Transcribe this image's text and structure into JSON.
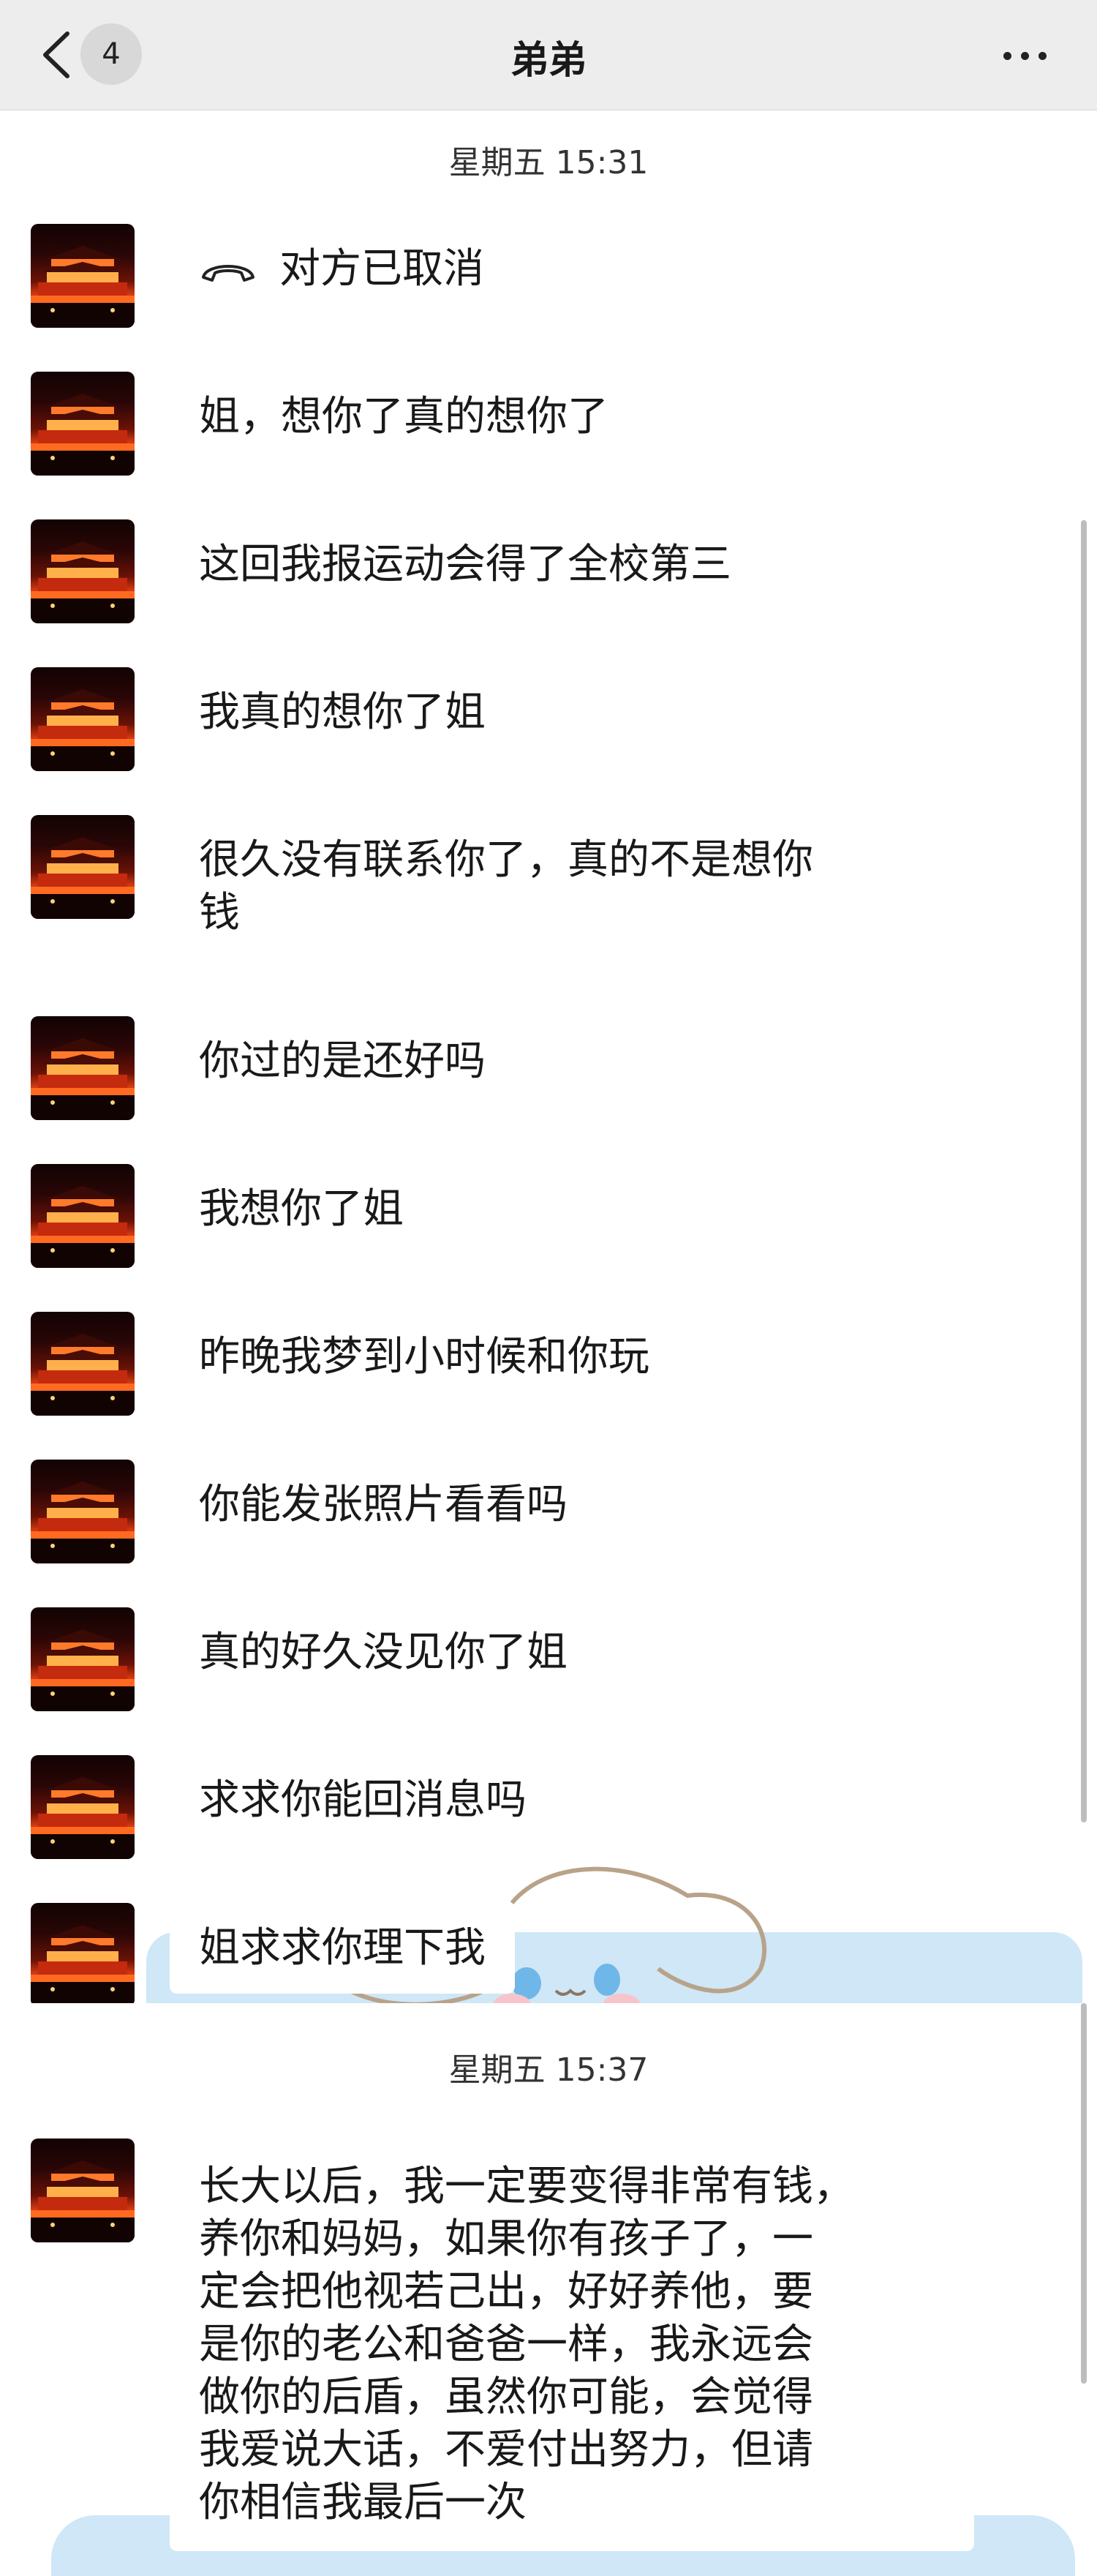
{
  "header": {
    "unread_count": "4",
    "title": "弟弟",
    "back_icon": "chevron-left-icon",
    "more_icon": "more-icon"
  },
  "section1": {
    "timestamp": "星期五 15:31",
    "messages": [
      {
        "call_icon": "phone-hangup-icon",
        "text": "对方已取消"
      },
      {
        "text": "姐，想你了真的想你了"
      },
      {
        "text": "这回我报运动会得了全校第三"
      },
      {
        "text": "我真的想你了姐"
      },
      {
        "line1": "很久没有联系你了，真的不是想你",
        "line2": "钱"
      },
      {
        "text": "你过的是还好吗"
      },
      {
        "text": "我想你了姐"
      },
      {
        "text": "昨晚我梦到小时候和你玩"
      },
      {
        "text": "你能发张照片看看吗"
      },
      {
        "text": "真的好久没见你了姐"
      },
      {
        "text": "求求你能回消息吗"
      },
      {
        "text": "姐求求你理下我"
      }
    ]
  },
  "section2": {
    "timestamp": "星期五 15:37",
    "message_lines": [
      "长大以后，我一定要变得非常有钱，",
      "养你和妈妈，如果你有孩子了，一",
      "定会把他视若己出，好好养他，要",
      "是你的老公和爸爸一样，我永远会",
      "做你的后盾，虽然你可能，会觉得",
      "我爱说大话，不爱付出努力，但请",
      "你相信我最后一次"
    ]
  },
  "colors": {
    "header_bg": "#ededed",
    "chat_bg": "#ffffff",
    "sticker_blue": "#cfe7f6"
  }
}
